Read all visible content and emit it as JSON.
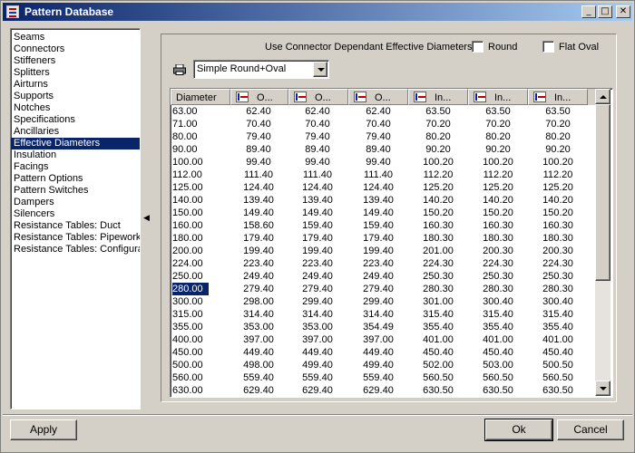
{
  "window": {
    "title": "Pattern Database",
    "controls": {
      "minimize": "_",
      "maximize": "□",
      "close": "✕"
    }
  },
  "sidebar": {
    "items": [
      {
        "label": "Seams",
        "selected": false
      },
      {
        "label": "Connectors",
        "selected": false
      },
      {
        "label": "Stiffeners",
        "selected": false
      },
      {
        "label": "Splitters",
        "selected": false
      },
      {
        "label": "Airturns",
        "selected": false
      },
      {
        "label": "Supports",
        "selected": false
      },
      {
        "label": "Notches",
        "selected": false
      },
      {
        "label": "Specifications",
        "selected": false
      },
      {
        "label": "Ancillaries",
        "selected": false
      },
      {
        "label": "Effective Diameters",
        "selected": true
      },
      {
        "label": "Insulation",
        "selected": false
      },
      {
        "label": "Facings",
        "selected": false
      },
      {
        "label": "Pattern Options",
        "selected": false
      },
      {
        "label": "Pattern Switches",
        "selected": false
      },
      {
        "label": "Dampers",
        "selected": false
      },
      {
        "label": "Silencers",
        "selected": false
      },
      {
        "label": "Resistance Tables: Duct",
        "selected": false
      },
      {
        "label": "Resistance Tables: Pipework",
        "selected": false
      },
      {
        "label": "Resistance Tables: Configura",
        "selected": false
      }
    ]
  },
  "options": {
    "use_connector_label": "Use Connector Dependant Effective Diameters",
    "round_label": "Round",
    "round_checked": false,
    "flat_oval_label": "Flat Oval",
    "flat_oval_checked": false
  },
  "combo": {
    "selected": "Simple Round+Oval"
  },
  "grid": {
    "columns": [
      "Diameter",
      "O...",
      "O...",
      "O...",
      "In...",
      "In...",
      "In..."
    ],
    "selected_row_index": 14,
    "rows": [
      [
        "63.00",
        "62.40",
        "62.40",
        "62.40",
        "63.50",
        "63.50",
        "63.50"
      ],
      [
        "71.00",
        "70.40",
        "70.40",
        "70.40",
        "70.20",
        "70.20",
        "70.20"
      ],
      [
        "80.00",
        "79.40",
        "79.40",
        "79.40",
        "80.20",
        "80.20",
        "80.20"
      ],
      [
        "90.00",
        "89.40",
        "89.40",
        "89.40",
        "90.20",
        "90.20",
        "90.20"
      ],
      [
        "100.00",
        "99.40",
        "99.40",
        "99.40",
        "100.20",
        "100.20",
        "100.20"
      ],
      [
        "112.00",
        "111.40",
        "111.40",
        "111.40",
        "112.20",
        "112.20",
        "112.20"
      ],
      [
        "125.00",
        "124.40",
        "124.40",
        "124.40",
        "125.20",
        "125.20",
        "125.20"
      ],
      [
        "140.00",
        "139.40",
        "139.40",
        "139.40",
        "140.20",
        "140.20",
        "140.20"
      ],
      [
        "150.00",
        "149.40",
        "149.40",
        "149.40",
        "150.20",
        "150.20",
        "150.20"
      ],
      [
        "160.00",
        "158.60",
        "159.40",
        "159.40",
        "160.30",
        "160.30",
        "160.30"
      ],
      [
        "180.00",
        "179.40",
        "179.40",
        "179.40",
        "180.30",
        "180.30",
        "180.30"
      ],
      [
        "200.00",
        "199.40",
        "199.40",
        "199.40",
        "201.00",
        "200.30",
        "200.30"
      ],
      [
        "224.00",
        "223.40",
        "223.40",
        "223.40",
        "224.30",
        "224.30",
        "224.30"
      ],
      [
        "250.00",
        "249.40",
        "249.40",
        "249.40",
        "250.30",
        "250.30",
        "250.30"
      ],
      [
        "280.00",
        "279.40",
        "279.40",
        "279.40",
        "280.30",
        "280.30",
        "280.30"
      ],
      [
        "300.00",
        "298.00",
        "299.40",
        "299.40",
        "301.00",
        "300.40",
        "300.40"
      ],
      [
        "315.00",
        "314.40",
        "314.40",
        "314.40",
        "315.40",
        "315.40",
        "315.40"
      ],
      [
        "355.00",
        "353.00",
        "353.00",
        "354.49",
        "355.40",
        "355.40",
        "355.40"
      ],
      [
        "400.00",
        "397.00",
        "397.00",
        "397.00",
        "401.00",
        "401.00",
        "401.00"
      ],
      [
        "450.00",
        "449.40",
        "449.40",
        "449.40",
        "450.40",
        "450.40",
        "450.40"
      ],
      [
        "500.00",
        "498.00",
        "499.40",
        "499.40",
        "502.00",
        "503.00",
        "500.50"
      ],
      [
        "560.00",
        "559.40",
        "559.40",
        "559.40",
        "560.50",
        "560.50",
        "560.50"
      ],
      [
        "630.00",
        "629.40",
        "629.40",
        "629.40",
        "630.50",
        "630.50",
        "630.50"
      ]
    ]
  },
  "footer": {
    "apply": "Apply",
    "ok": "Ok",
    "cancel": "Cancel"
  }
}
